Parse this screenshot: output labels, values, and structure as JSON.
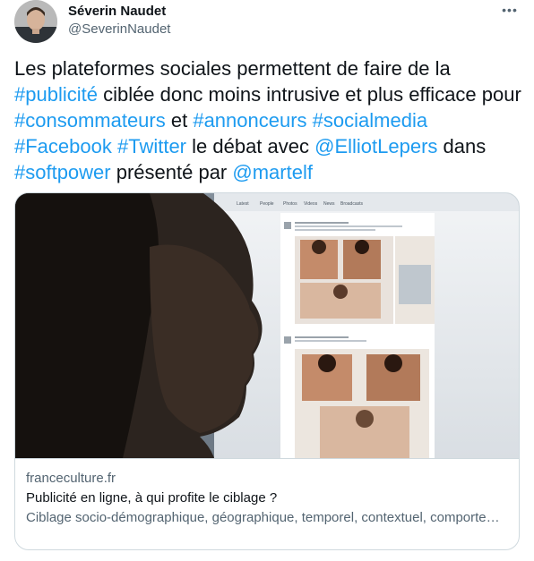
{
  "author": {
    "name": "Séverin Naudet",
    "handle": "@SeverinNaudet",
    "more_icon": "more-dots-icon"
  },
  "tweet": {
    "segments": [
      {
        "text": "Les plateformes sociales permettent de faire de la ",
        "link": false
      },
      {
        "text": "#publicité",
        "link": true
      },
      {
        "text": " ciblée donc moins intrusive et plus efficace pour ",
        "link": false
      },
      {
        "text": "#consommateurs",
        "link": true
      },
      {
        "text": " et ",
        "link": false
      },
      {
        "text": "#annonceurs",
        "link": true
      },
      {
        "text": " ",
        "link": false
      },
      {
        "text": "#socialmedia",
        "link": true
      },
      {
        "text": " ",
        "link": false
      },
      {
        "text": "#Facebook",
        "link": true
      },
      {
        "text": " ",
        "link": false
      },
      {
        "text": "#Twitter",
        "link": true
      },
      {
        "text": " le débat avec ",
        "link": false
      },
      {
        "text": "@ElliotLepers",
        "link": true
      },
      {
        "text": " dans ",
        "link": false
      },
      {
        "text": "#softpower",
        "link": true
      },
      {
        "text": " présenté par ",
        "link": false
      },
      {
        "text": "@martelf",
        "link": true
      }
    ]
  },
  "card": {
    "domain": "franceculture.fr",
    "title": "Publicité en ligne, à qui profite le ciblage ?",
    "description": "Ciblage socio-démographique, géographique, temporel, contextuel, comportemental, retargeting… Les données collectées via les cookies déposés…",
    "image_tabs": [
      "Latest",
      "People",
      "Photos",
      "Videos",
      "News",
      "Broadcasts"
    ]
  },
  "colors": {
    "link": "#1d9bf0",
    "text": "#0f1419",
    "secondary": "#536471",
    "border": "#cfd9de"
  }
}
